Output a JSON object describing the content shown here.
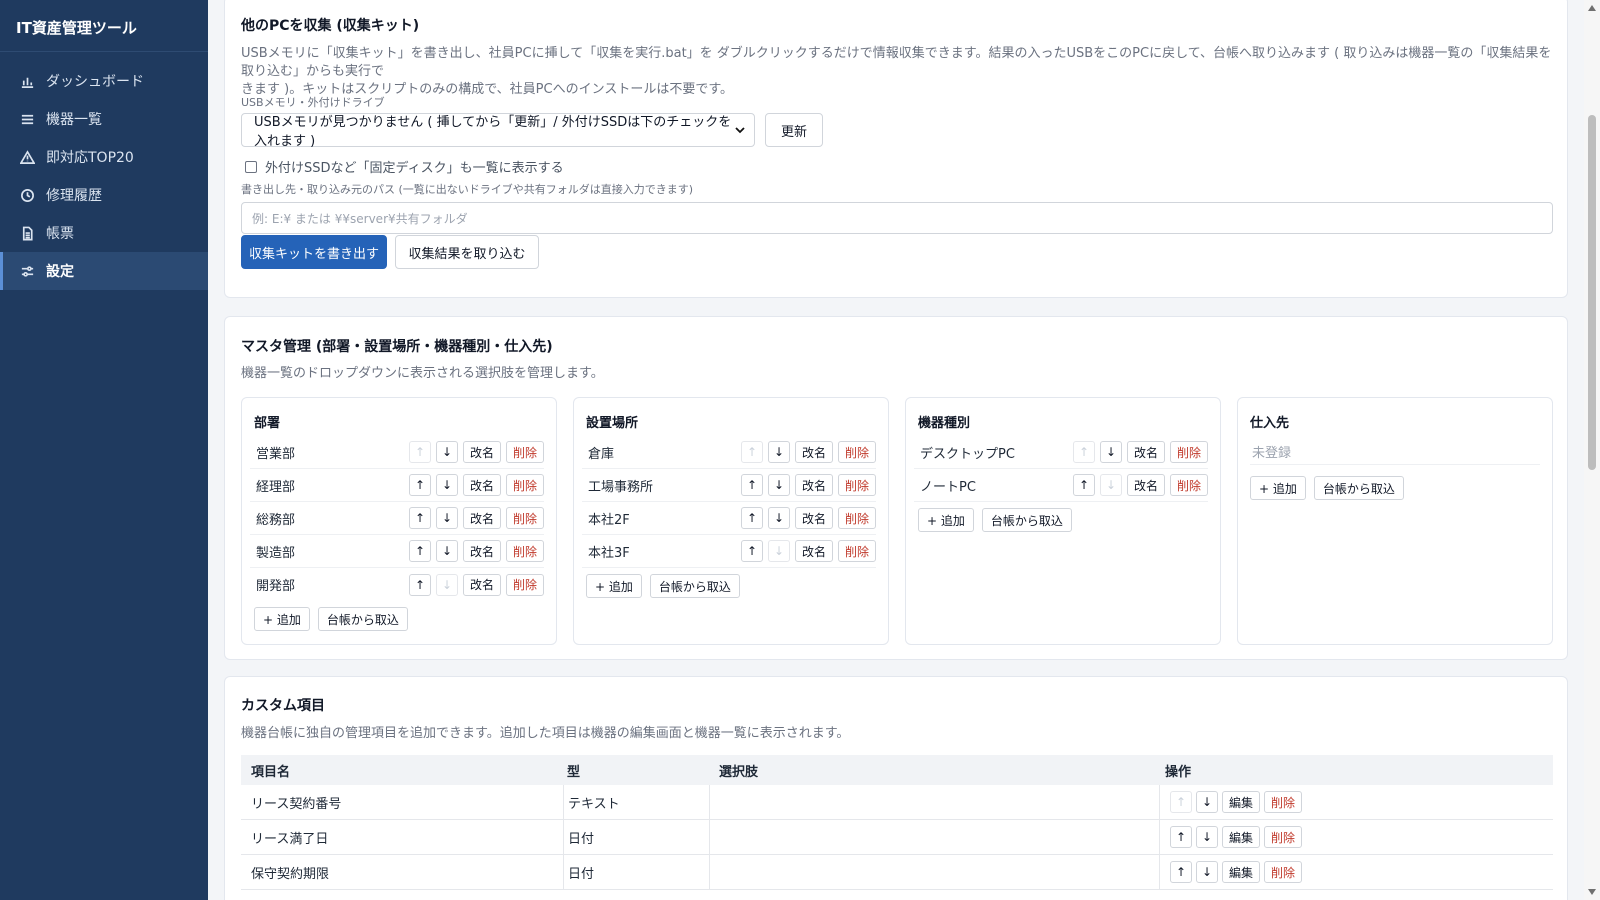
{
  "app": {
    "title": "IT資産管理ツール"
  },
  "sidebar": {
    "items": [
      {
        "label": "ダッシュボード",
        "icon": "bar-chart-icon"
      },
      {
        "label": "機器一覧",
        "icon": "list-icon"
      },
      {
        "label": "即対応TOP20",
        "icon": "warning-icon"
      },
      {
        "label": "修理履歴",
        "icon": "clock-icon"
      },
      {
        "label": "帳票",
        "icon": "document-icon"
      },
      {
        "label": "設定",
        "icon": "sliders-icon",
        "active": true
      }
    ]
  },
  "collect": {
    "title": "他のPCを収集 (収集キット)",
    "desc_line1": "USBメモリに「収集キット」を書き出し、社員PCに挿して「収集を実行.bat」を ダブルクリックするだけで情報収集できます。結果の入ったUSBをこのPCに戻して、台帳へ取り込みます ( 取り込みは機器一覧の「収集結果を取り込む」からも実行で",
    "desc_line2": "きます )。キットはスクリプトのみの構成で、社員PCへのインストールは不要です。",
    "drive_label": "USBメモリ・外付けドライブ",
    "drive_selected": "USBメモリが見つかりません ( 挿してから「更新」/ 外付けSSDは下のチェックを入れます )",
    "refresh_label": "更新",
    "fixed_disk_label": "外付けSSDなど「固定ディスク」も一覧に表示する",
    "path_label": "書き出し先・取り込み元のパス (一覧に出ないドライブや共有フォルダは直接入力できます)",
    "path_placeholder": "例: E:¥ または ¥¥server¥共有フォルダ",
    "write_kit_label": "収集キットを書き出す",
    "import_label": "収集結果を取り込む"
  },
  "master": {
    "title": "マスタ管理 (部署・設置場所・機器種別・仕入先)",
    "desc": "機器一覧のドロップダウンに表示される選択肢を管理します。",
    "rename_label": "改名",
    "delete_label": "削除",
    "up_symbol": "↑",
    "down_symbol": "↓",
    "add_label": "+ 追加",
    "import_label": "台帳から取込",
    "empty_label": "未登録",
    "groups": [
      {
        "title": "部署",
        "items": [
          "営業部",
          "経理部",
          "総務部",
          "製造部",
          "開発部"
        ]
      },
      {
        "title": "設置場所",
        "items": [
          "倉庫",
          "工場事務所",
          "本社2F",
          "本社3F"
        ]
      },
      {
        "title": "機器種別",
        "items": [
          "デスクトップPC",
          "ノートPC"
        ]
      },
      {
        "title": "仕入先",
        "items": []
      }
    ]
  },
  "custom": {
    "title": "カスタム項目",
    "desc": "機器台帳に独自の管理項目を追加できます。追加した項目は機器の編集画面と機器一覧に表示されます。",
    "headers": [
      "項目名",
      "型",
      "選択肢",
      "操作"
    ],
    "edit_label": "編集",
    "delete_label": "削除",
    "rows": [
      {
        "name": "リース契約番号",
        "type": "テキスト",
        "choices": ""
      },
      {
        "name": "リース満了日",
        "type": "日付",
        "choices": ""
      },
      {
        "name": "保守契約期限",
        "type": "日付",
        "choices": ""
      }
    ]
  }
}
